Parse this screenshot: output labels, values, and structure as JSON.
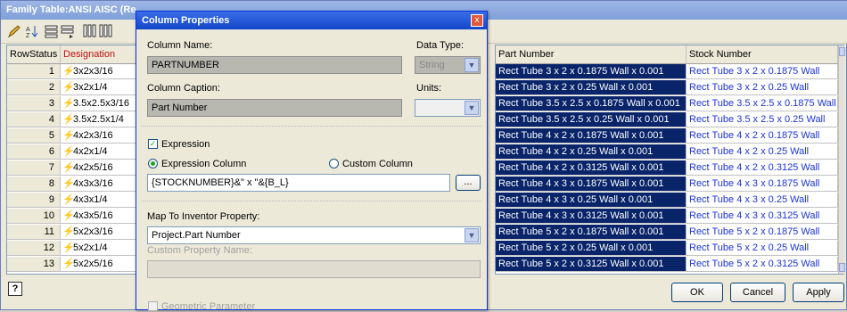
{
  "main_window": {
    "title": "Family Table:ANSI AISC (Re",
    "columns": {
      "rowstatus": "RowStatus",
      "designation": "Designation",
      "part_number": "Part Number",
      "stock_number": "Stock Number"
    },
    "rows": [
      {
        "n": "1",
        "des": "3x2x3/16",
        "pn": "Rect Tube 3 x 2 x 0.1875 Wall x 0.001",
        "sn": "Rect Tube 3 x 2 x 0.1875 Wall"
      },
      {
        "n": "2",
        "des": "3x2x1/4",
        "pn": "Rect Tube 3 x 2 x 0.25 Wall x 0.001",
        "sn": "Rect Tube 3 x 2 x 0.25 Wall"
      },
      {
        "n": "3",
        "des": "3.5x2.5x3/16",
        "pn": "Rect Tube 3.5 x 2.5 x 0.1875 Wall x 0.001",
        "sn": "Rect Tube 3.5 x 2.5 x 0.1875 Wall"
      },
      {
        "n": "4",
        "des": "3.5x2.5x1/4",
        "pn": "Rect Tube 3.5 x 2.5 x 0.25 Wall x 0.001",
        "sn": "Rect Tube 3.5 x 2.5 x 0.25 Wall"
      },
      {
        "n": "5",
        "des": "4x2x3/16",
        "pn": "Rect Tube 4 x 2 x 0.1875 Wall x 0.001",
        "sn": "Rect Tube 4 x 2 x 0.1875 Wall"
      },
      {
        "n": "6",
        "des": "4x2x1/4",
        "pn": "Rect Tube 4 x 2 x 0.25 Wall x 0.001",
        "sn": "Rect Tube 4 x 2 x 0.25 Wall"
      },
      {
        "n": "7",
        "des": "4x2x5/16",
        "pn": "Rect Tube 4 x 2 x 0.3125 Wall x 0.001",
        "sn": "Rect Tube 4 x 2 x 0.3125 Wall"
      },
      {
        "n": "8",
        "des": "4x3x3/16",
        "pn": "Rect Tube 4 x 3 x 0.1875 Wall x 0.001",
        "sn": "Rect Tube 4 x 3 x 0.1875 Wall"
      },
      {
        "n": "9",
        "des": "4x3x1/4",
        "pn": "Rect Tube 4 x 3 x 0.25 Wall x 0.001",
        "sn": "Rect Tube 4 x 3 x 0.25 Wall"
      },
      {
        "n": "10",
        "des": "4x3x5/16",
        "pn": "Rect Tube 4 x 3 x 0.3125 Wall x 0.001",
        "sn": "Rect Tube 4 x 3 x 0.3125 Wall"
      },
      {
        "n": "11",
        "des": "5x2x3/16",
        "pn": "Rect Tube 5 x 2 x 0.1875 Wall x 0.001",
        "sn": "Rect Tube 5 x 2 x 0.1875 Wall"
      },
      {
        "n": "12",
        "des": "5x2x1/4",
        "pn": "Rect Tube 5 x 2 x 0.25 Wall x 0.001",
        "sn": "Rect Tube 5 x 2 x 0.25 Wall"
      },
      {
        "n": "13",
        "des": "5x2x5/16",
        "pn": "Rect Tube 5 x 2 x 0.3125 Wall x 0.001",
        "sn": "Rect Tube 5 x 2 x 0.3125 Wall"
      }
    ],
    "buttons": {
      "ok": "OK",
      "cancel": "Cancel",
      "apply": "Apply"
    }
  },
  "dialog": {
    "title": "Column Properties",
    "column_name_label": "Column Name:",
    "column_name_value": "PARTNUMBER",
    "data_type_label": "Data Type:",
    "data_type_value": "String",
    "column_caption_label": "Column Caption:",
    "column_caption_value": "Part Number",
    "units_label": "Units:",
    "units_value": "",
    "expression_label": "Expression",
    "expression_checked": true,
    "expression_column_label": "Expression Column",
    "custom_column_label": "Custom Column",
    "expression_value": "{STOCKNUMBER}&\" x \"&{B_L}",
    "browse_label": "...",
    "map_label": "Map To Inventor Property:",
    "map_value": "Project.Part Number",
    "custom_property_label": "Custom Property Name:",
    "custom_property_value": "",
    "geometric_label": "Geometric Parameter"
  },
  "colors": {
    "selection": "#0a246a",
    "link_text": "#1c33d6",
    "dialog_title": "#1246c8"
  }
}
